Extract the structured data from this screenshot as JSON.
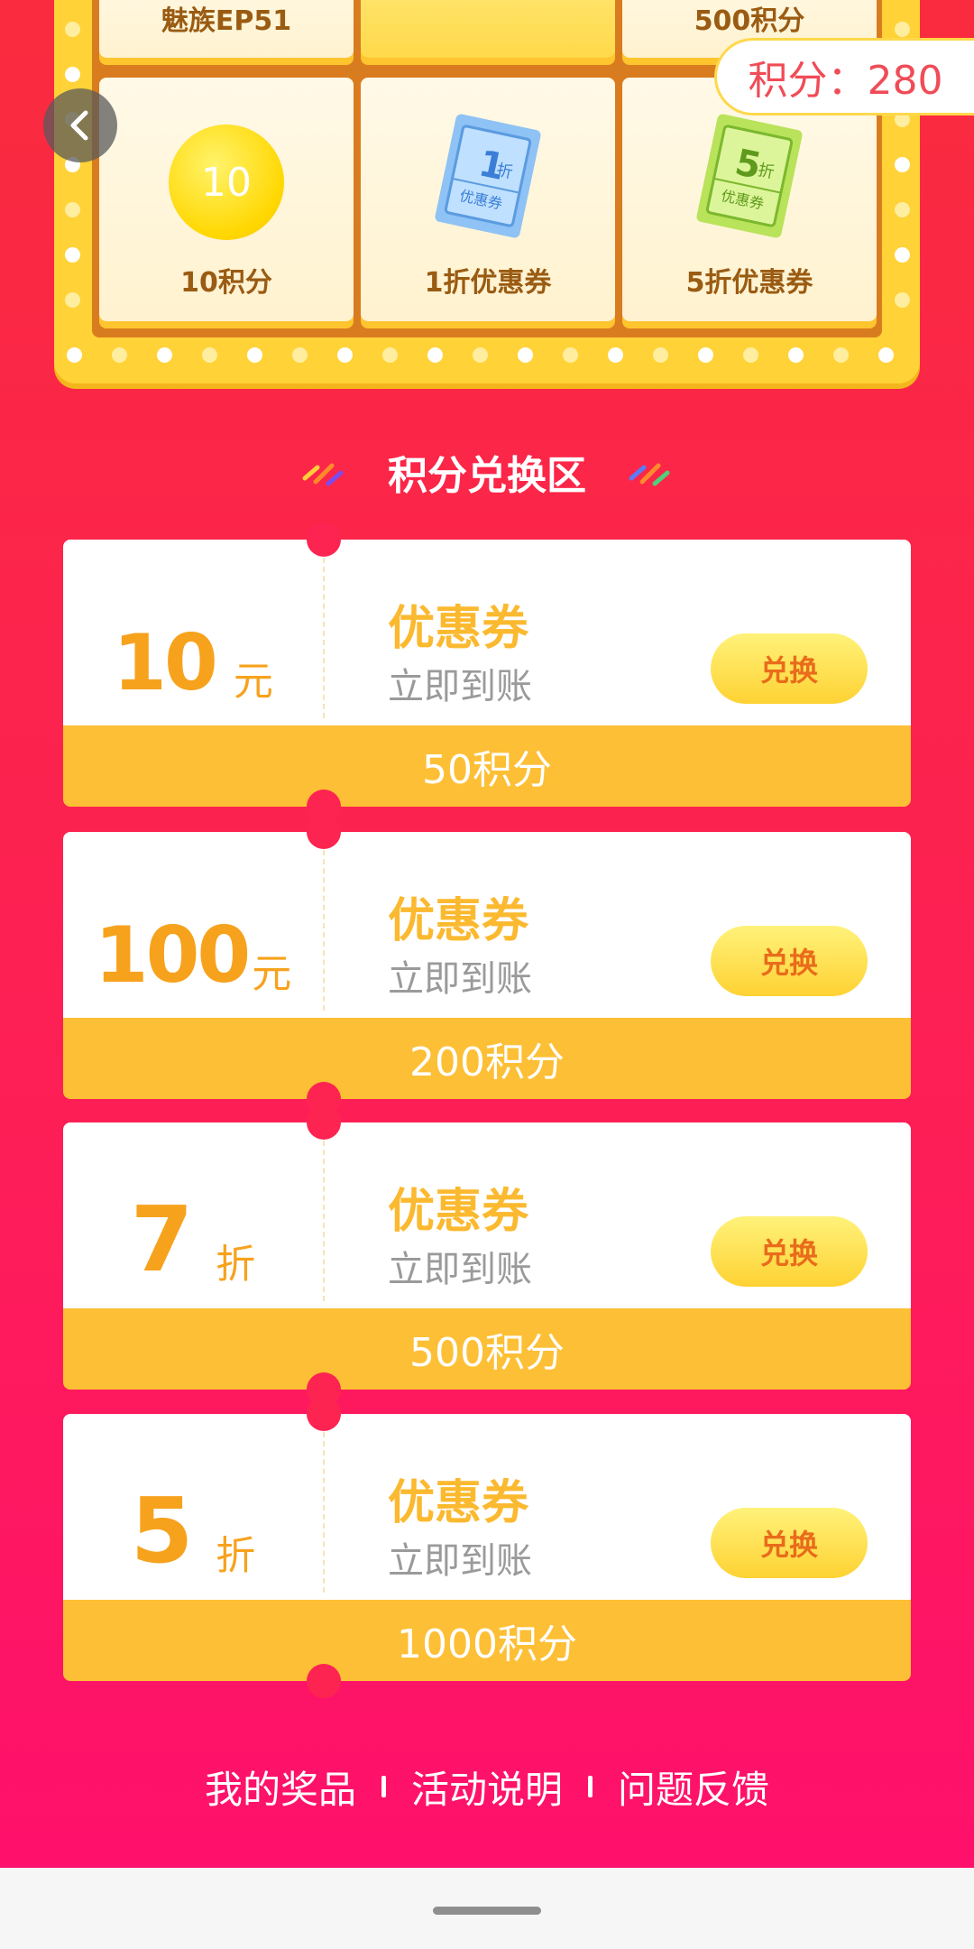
{
  "points_display": "积分：280",
  "grid": {
    "top_row": [
      {
        "label": "魅族EP51"
      },
      {
        "label": ""
      },
      {
        "label": "500积分"
      }
    ],
    "bottom_row": [
      {
        "label": "10积分",
        "coin_text": "10"
      },
      {
        "label": "1折优惠券",
        "ticket_big": "1",
        "ticket_unit": "折",
        "ticket_text": "优惠券"
      },
      {
        "label": "5折优惠券",
        "ticket_big": "5",
        "ticket_unit": "折",
        "ticket_text": "优惠券"
      }
    ]
  },
  "section_title": "积分兑换区",
  "coupons": [
    {
      "amount": "10",
      "unit": "元",
      "name": "优惠券",
      "sub": "立即到账",
      "button": "兑换",
      "cost": "50积分"
    },
    {
      "amount": "100",
      "unit": "元",
      "name": "优惠券",
      "sub": "立即到账",
      "button": "兑换",
      "cost": "200积分"
    },
    {
      "amount": "7",
      "unit": "折",
      "name": "优惠券",
      "sub": "立即到账",
      "button": "兑换",
      "cost": "500积分"
    },
    {
      "amount": "5",
      "unit": "折",
      "name": "优惠券",
      "sub": "立即到账",
      "button": "兑换",
      "cost": "1000积分"
    }
  ],
  "footer": {
    "links": [
      "我的奖品",
      "活动说明",
      "问题反馈"
    ]
  },
  "colors": {
    "accent_red": "#fa2b3e",
    "coupon_yellow": "#fdbf35",
    "amount_orange": "#f7a21d"
  }
}
